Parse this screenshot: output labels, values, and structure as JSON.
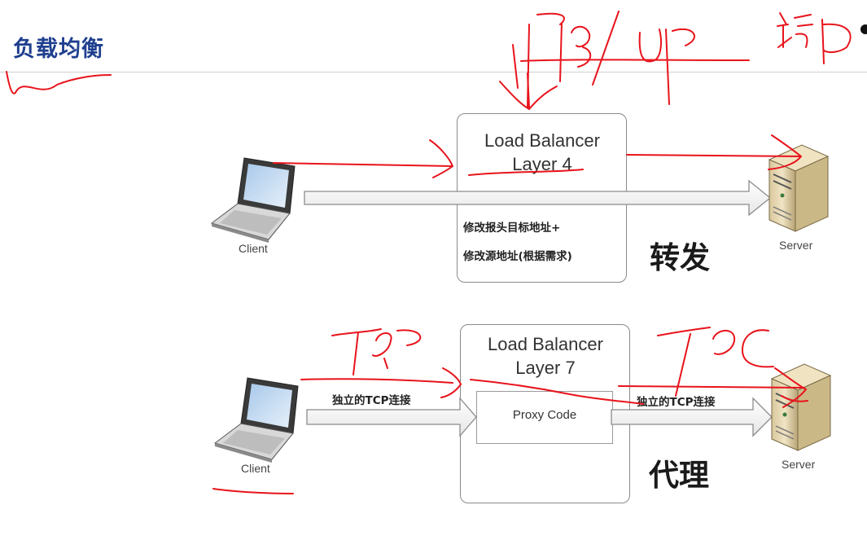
{
  "page": {
    "title": "负载均衡"
  },
  "layer4": {
    "box_line1": "Load Balancer",
    "box_line2": "Layer 4",
    "note_line1": "修改报头目标地址+",
    "note_line2": "修改源地址(根据需求)",
    "mode_label": "转发",
    "client_label": "Client",
    "server_label": "Server"
  },
  "layer7": {
    "box_line1": "Load Balancer",
    "box_line2": "Layer 7",
    "proxy_label": "Proxy Code",
    "left_conn_label": "独立的TCP连接",
    "right_conn_label": "独立的TCP连接",
    "mode_label": "代理",
    "client_label": "Client",
    "server_label": "Server"
  },
  "colors": {
    "title": "#1f3f8f",
    "annotation_red": "#e8131b",
    "arrow_fill": "#f4f4f4",
    "arrow_stroke": "#8c8c8c"
  }
}
